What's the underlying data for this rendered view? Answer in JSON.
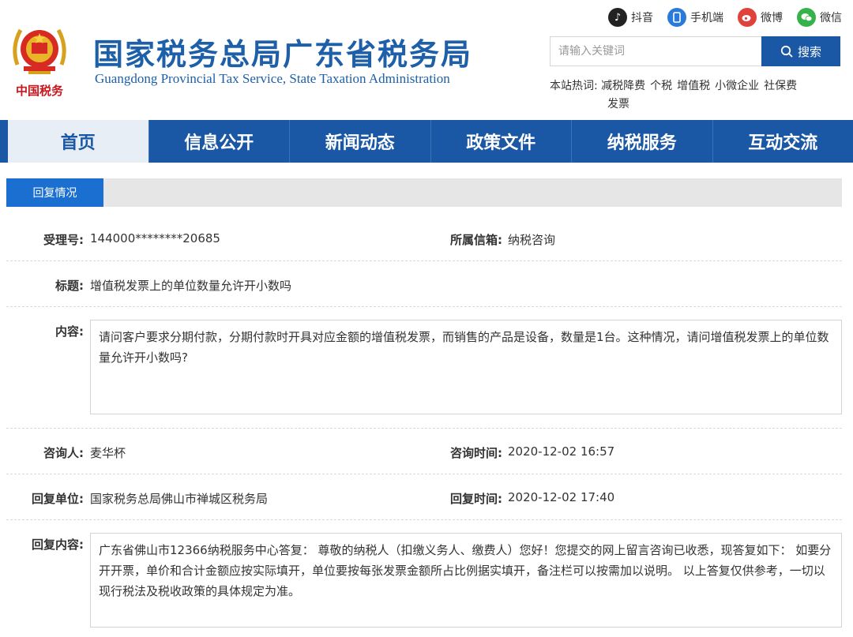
{
  "header": {
    "title": "国家税务总局广东省税务局",
    "subtitle": "Guangdong Provincial Tax Service, State Taxation Administration",
    "logo_caption": "中国税务"
  },
  "social": [
    {
      "label": "抖音",
      "icon": "douyin-icon",
      "color": "#222222"
    },
    {
      "label": "手机端",
      "icon": "mobile-icon",
      "color": "#2a7ad8"
    },
    {
      "label": "微博",
      "icon": "weibo-icon",
      "color": "#e0413b"
    },
    {
      "label": "微信",
      "icon": "wechat-icon",
      "color": "#35b34a"
    }
  ],
  "search": {
    "placeholder": "请输入关键词",
    "button_label": "搜索"
  },
  "hotwords": {
    "label": "本站热词:",
    "items": [
      "减税降费",
      "个税",
      "增值税",
      "小微企业",
      "社保费",
      "发票"
    ]
  },
  "nav": {
    "items": [
      "首页",
      "信息公开",
      "新闻动态",
      "政策文件",
      "纳税服务",
      "互动交流"
    ],
    "active_index": 0
  },
  "section": {
    "tab_label": "回复情况"
  },
  "record": {
    "accept_no_label": "受理号:",
    "accept_no": "144000********20685",
    "mailbox_label": "所属信箱:",
    "mailbox": "纳税咨询",
    "title_label": "标题:",
    "title": "增值税发票上的单位数量允许开小数吗",
    "content_label": "内容:",
    "content": "请问客户要求分期付款，分期付款时开具对应金额的增值税发票，而销售的产品是设备，数量是1台。这种情况，请问增值税发票上的单位数量允许开小数吗?",
    "consultant_label": "咨询人:",
    "consultant": "麦华杯",
    "consult_time_label": "咨询时间:",
    "consult_time": "2020-12-02 16:57",
    "reply_unit_label": "回复单位:",
    "reply_unit": "国家税务总局佛山市禅城区税务局",
    "reply_time_label": "回复时间:",
    "reply_time": "2020-12-02 17:40",
    "reply_content_label": "回复内容:",
    "reply_content": "广东省佛山市12366纳税服务中心答复：  尊敬的纳税人（扣缴义务人、缴费人）您好！您提交的网上留言咨询已收悉，现答复如下：  如要分开开票，单价和合计金额应按实际填开，单位要按每张发票金额所占比例据实填开，备注栏可以按需加以说明。  以上答复仅供参考，一切以现行税法及税收政策的具体规定为准。"
  }
}
